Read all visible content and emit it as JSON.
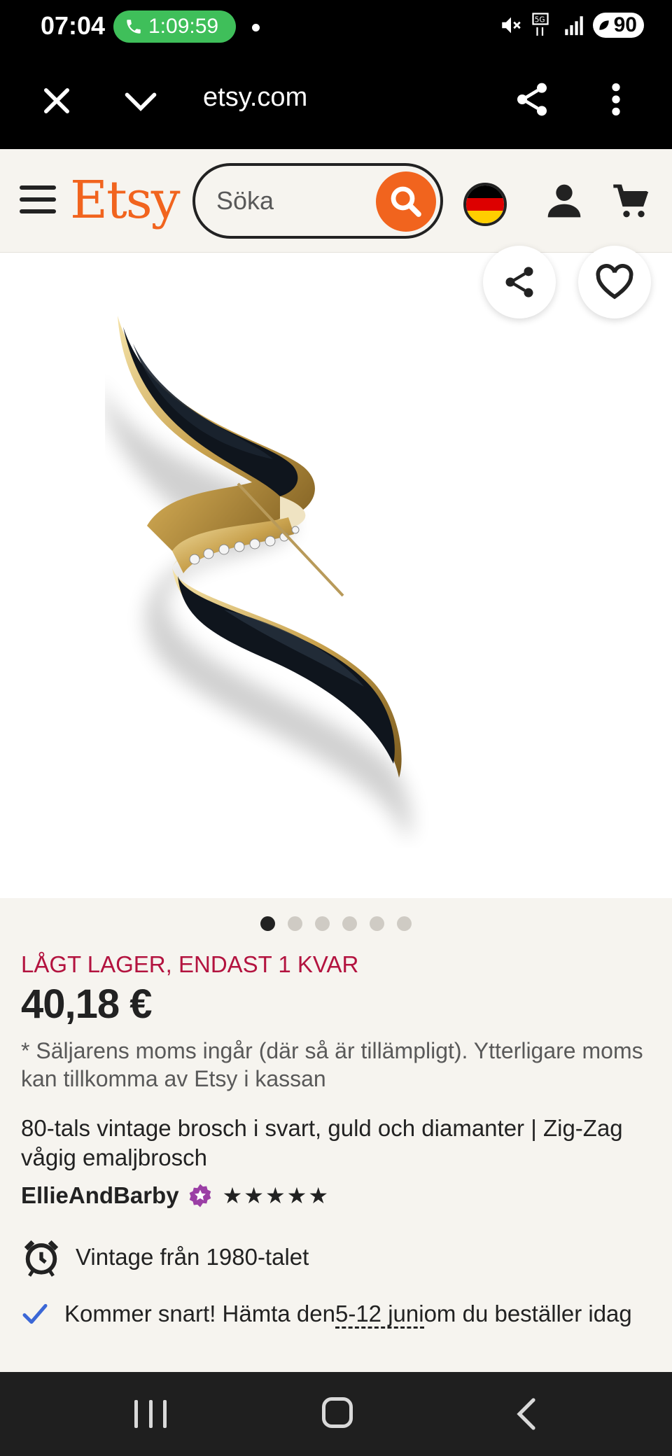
{
  "status_bar": {
    "time": "07:04",
    "call_duration": "1:09:59",
    "battery": "90"
  },
  "browser": {
    "url": "etsy.com"
  },
  "header": {
    "logo": "Etsy",
    "search_placeholder": "Söka"
  },
  "product": {
    "image_count": 6,
    "active_image_index": 0,
    "stock_notice": "LÅGT LAGER, ENDAST 1 KVAR",
    "price": "40,18 €",
    "vat_note": "* Säljarens moms ingår (där så är tillämpligt). Ytterligare moms kan tillkomma av Etsy i kassan",
    "title": "80-tals vintage brosch i svart, guld och diamanter | Zig-Zag vågig emaljbrosch",
    "shop_name": "EllieAndBarby",
    "rating_stars": "★★★★★",
    "rating": 5,
    "vintage_label": "Vintage från 1980-talet",
    "arrival_prefix": "Kommer snart! Hämta den",
    "arrival_dates": "5-12 juni",
    "arrival_suffix": "om du beställer idag"
  },
  "colors": {
    "brand_orange": "#f1641e",
    "stock_red": "#b3133f",
    "check_blue": "#3b67d6",
    "star_seller_purple": "#9b3fa5"
  }
}
